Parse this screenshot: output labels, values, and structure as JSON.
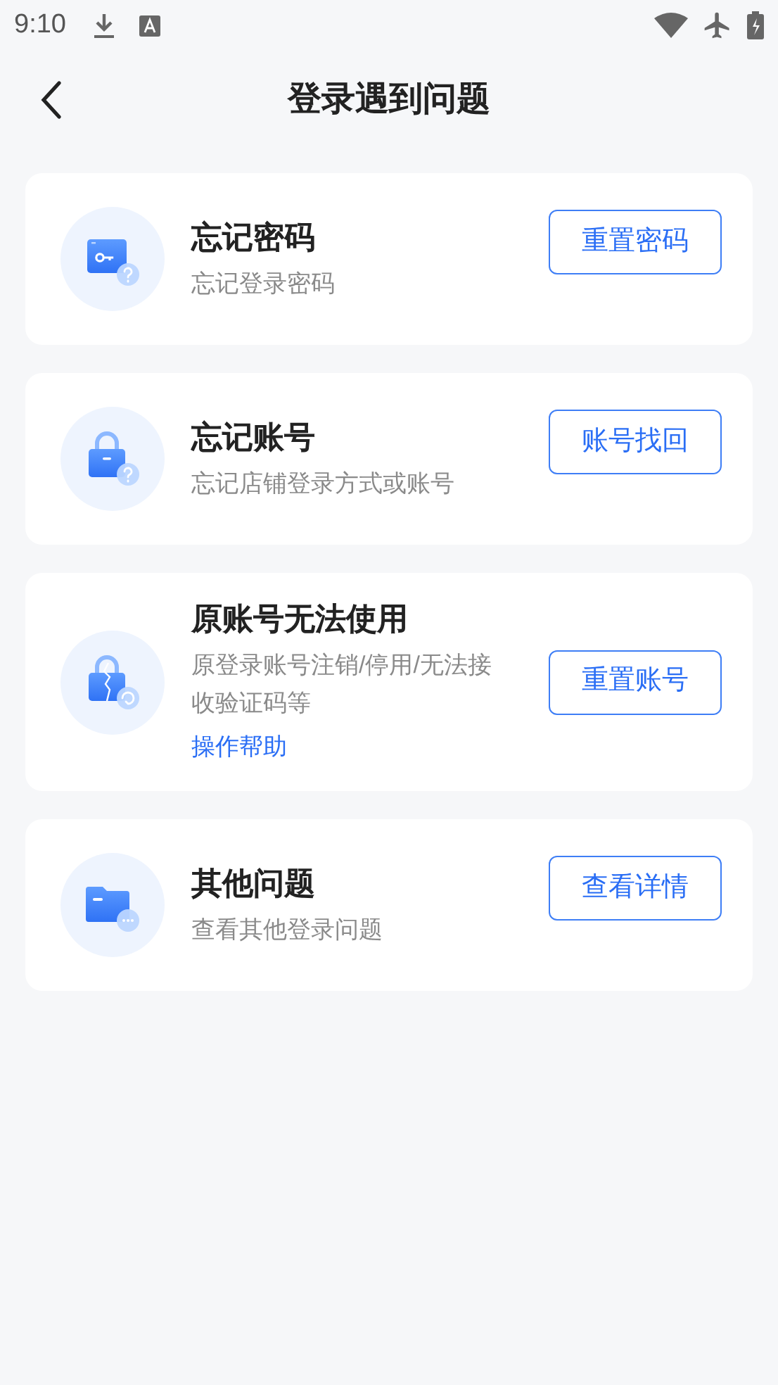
{
  "status_bar": {
    "time": "9:10"
  },
  "header": {
    "title": "登录遇到问题"
  },
  "cards": [
    {
      "kind": "password",
      "title": "忘记密码",
      "description": "忘记登录密码",
      "button": "重置密码"
    },
    {
      "kind": "lock",
      "title": "忘记账号",
      "description": "忘记店铺登录方式或账号",
      "button": "账号找回"
    },
    {
      "kind": "broken-lock",
      "title": "原账号无法使用",
      "description": "原登录账号注销/停用/无法接收验证码等",
      "link": "操作帮助",
      "button": "重置账号"
    },
    {
      "kind": "folder",
      "title": "其他问题",
      "description": "查看其他登录问题",
      "button": "查看详情"
    }
  ]
}
